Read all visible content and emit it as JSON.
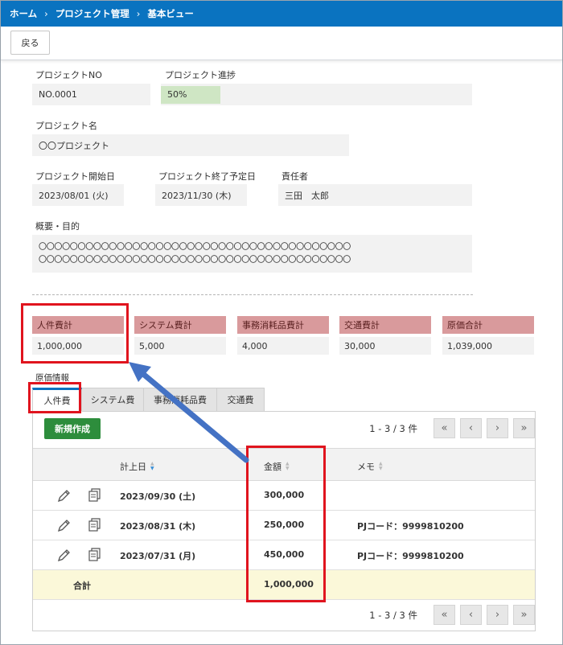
{
  "breadcrumb": {
    "home": "ホーム",
    "project_mgmt": "プロジェクト管理",
    "current": "基本ビュー",
    "separator": "›"
  },
  "toolbar": {
    "back_label": "戻る"
  },
  "project": {
    "no_label": "プロジェクトNO",
    "no_value": "NO.0001",
    "progress_label": "プロジェクト進捗",
    "progress_value": "50%",
    "progress_fraction": 0.5,
    "name_label": "プロジェクト名",
    "name_value": "〇〇プロジェクト",
    "start_label": "プロジェクト開始日",
    "start_value": "2023/08/01 (火)",
    "end_label": "プロジェクト終了予定日",
    "end_value": "2023/11/30 (木)",
    "owner_label": "責任者",
    "owner_value": "三田　太郎",
    "summary_label": "概要・目的",
    "summary_line1": "〇〇〇〇〇〇〇〇〇〇〇〇〇〇〇〇〇〇〇〇〇〇〇〇〇〇〇〇〇〇〇〇〇〇〇〇〇〇〇〇",
    "summary_line2": "〇〇〇〇〇〇〇〇〇〇〇〇〇〇〇〇〇〇〇〇〇〇〇〇〇〇〇〇〇〇〇〇〇〇〇〇〇〇〇〇"
  },
  "costs": [
    {
      "label": "人件費計",
      "value": "1,000,000"
    },
    {
      "label": "システム費計",
      "value": "5,000"
    },
    {
      "label": "事務消耗品費計",
      "value": "4,000"
    },
    {
      "label": "交通費計",
      "value": "30,000"
    },
    {
      "label": "原価合計",
      "value": "1,039,000"
    }
  ],
  "cost_section_title": "原価情報",
  "tabs": [
    "人件費",
    "システム費",
    "事務消耗品費",
    "交通費"
  ],
  "table": {
    "new_button": "新規作成",
    "pager_info": "1 - 3 / 3 件",
    "headers": {
      "date": "計上日",
      "amount": "金額",
      "memo": "メモ"
    },
    "rows": [
      {
        "date": "2023/09/30 (土)",
        "amount": "300,000",
        "memo": ""
      },
      {
        "date": "2023/08/31 (木)",
        "amount": "250,000",
        "memo": "PJコード：9999810200"
      },
      {
        "date": "2023/07/31 (月)",
        "amount": "450,000",
        "memo": "PJコード：9999810200"
      }
    ],
    "total_label": "合計",
    "total_value": "1,000,000"
  },
  "colors": {
    "header_blue": "#0a73c0",
    "cost_header": "#d99a9c",
    "highlight_red": "#e0141e",
    "arrow_blue": "#4472c4",
    "new_button_green": "#2d8d3c",
    "total_row": "#fbf8d9",
    "progress_fill": "#cfe6c4"
  }
}
